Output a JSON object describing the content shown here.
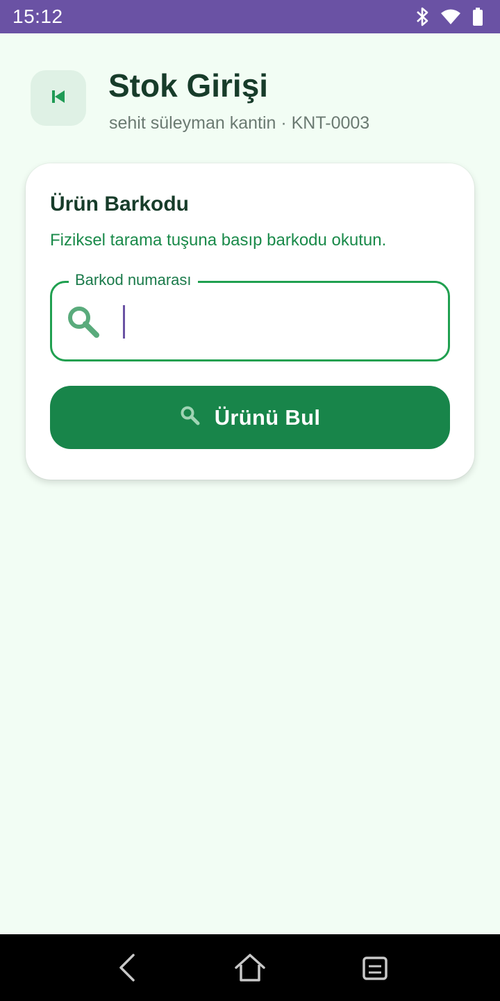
{
  "status_bar": {
    "time": "15:12",
    "icons": [
      "bluetooth-icon",
      "wifi-icon",
      "battery-icon"
    ]
  },
  "header": {
    "back_icon": "skip-back-icon",
    "title": "Stok Girişi",
    "subtitle": "sehit süleyman kantin · KNT-0003"
  },
  "card": {
    "title": "Ürün Barkodu",
    "description": "Fiziksel tarama tuşuna basıp barkodu okutun.",
    "barcode_field": {
      "label": "Barkod numarası",
      "value": "",
      "icon": "search-icon"
    },
    "find_button": {
      "label": "Ürünü Bul",
      "icon": "search-icon"
    }
  },
  "nav_bar": {
    "buttons": [
      "back-icon",
      "home-icon",
      "recents-icon"
    ]
  },
  "colors": {
    "status_bar": "#6a52a4",
    "background": "#f2fdf4",
    "primary_green": "#18854a",
    "field_border": "#20a050",
    "title_text": "#173c2a"
  }
}
